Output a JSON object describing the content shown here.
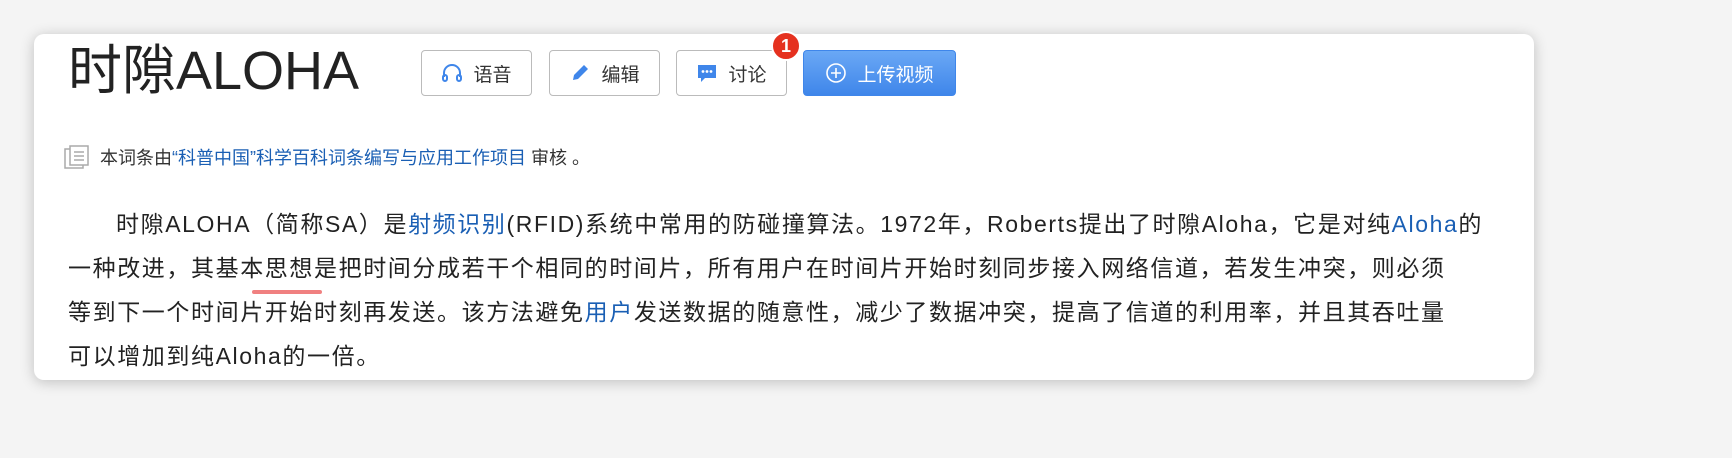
{
  "title": "时隙ALOHA",
  "buttons": {
    "voice": "语音",
    "edit": "编辑",
    "discuss": "讨论",
    "upload": "上传视频"
  },
  "discuss_badge": "1",
  "review": {
    "prefix": "本词条由",
    "link": "“科普中国”科学百科词条编写与应用工作项目",
    "suffix": " 审核 。"
  },
  "paragraph": {
    "l1": {
      "a": "时隙ALOHA（简称SA）是",
      "link1": "射频识别",
      "b": "(RFID)系统中常用的防碰撞算法。1972年，Roberts提出了时隙Aloha，它是对纯",
      "link2": "Aloha",
      "c": "的"
    },
    "l2": "一种改进，其基本思想是把时间分成若干个相同的时间片，所有用户在时间片开始时刻同步接入网络信道，若发生冲突，则必须",
    "l3": {
      "a": "等到下一个时间片开始时刻再发送。该方法避免",
      "link": "用户",
      "b": "发送数据的随意性，减少了数据冲突，提高了信道的利用率，并且其吞吐量"
    },
    "l4": "可以增加到纯Aloha的一倍。"
  },
  "colors": {
    "link": "#1a5fb4",
    "primary": "#3f86ea",
    "badge": "#e5311f"
  }
}
